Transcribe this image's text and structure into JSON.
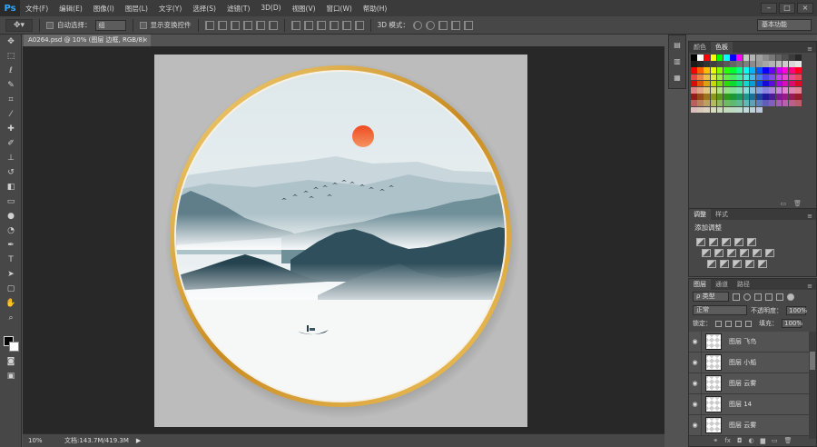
{
  "app": {
    "logo": "Ps"
  },
  "menu": [
    "文件(F)",
    "编辑(E)",
    "图像(I)",
    "图层(L)",
    "文字(Y)",
    "选择(S)",
    "滤镜(T)",
    "3D(D)",
    "视图(V)",
    "窗口(W)",
    "帮助(H)"
  ],
  "window_controls": {
    "minimize": "–",
    "maximize": "□",
    "close": "×"
  },
  "options_bar": {
    "tool_preset_icon": "move-tool-icon",
    "auto_select_label": "自动选择：",
    "auto_select_value": "组",
    "show_transform_label": "显示变换控件",
    "mode_3d_label": "3D 模式：",
    "workspace": "基本功能"
  },
  "document": {
    "tab_title": "A0264.psd @ 10% (图层 边框, RGB/8)",
    "tab_close": "×",
    "zoom": "10%",
    "doc_info": "文档:143.7M/419.3M",
    "status_arrow": "▶"
  },
  "swatch_panel": {
    "tabs": [
      "颜色",
      "色板"
    ],
    "active_tab": "色板",
    "menu": "≡",
    "footer_new": "▭",
    "footer_delete": "🗑"
  },
  "adjust_panel": {
    "tabs": [
      "调整",
      "样式"
    ],
    "active_tab": "调整",
    "menu": "≡",
    "title": "添加调整"
  },
  "layers_panel": {
    "tabs": [
      "图层",
      "通道",
      "路径"
    ],
    "active_tab": "图层",
    "menu": "≡",
    "kind_filter": "ρ 类型",
    "blend_mode": "正常",
    "opacity_label": "不透明度：",
    "opacity_value": "100%",
    "lock_label": "锁定：",
    "fill_label": "填充：",
    "fill_value": "100%",
    "eye_glyph": "◉",
    "layers": [
      {
        "name": "图层 飞鸟"
      },
      {
        "name": "图层 小船"
      },
      {
        "name": "图层 云雾"
      },
      {
        "name": "图层 14"
      },
      {
        "name": "图层 云雾"
      }
    ],
    "footer_icons": [
      "link-icon",
      "fx-icon",
      "mask-icon",
      "adjustment-icon",
      "folder-icon",
      "new-layer-icon",
      "trash-icon"
    ],
    "footer_glyphs": [
      "⚭",
      "fx",
      "◘",
      "◐",
      "▆",
      "▭",
      "🗑"
    ]
  },
  "colors": {
    "canvas_bg": "#282828",
    "doc_bg": "#bcbcbc",
    "frame_gold": "#d7a33a",
    "sun": "#e8442a"
  }
}
